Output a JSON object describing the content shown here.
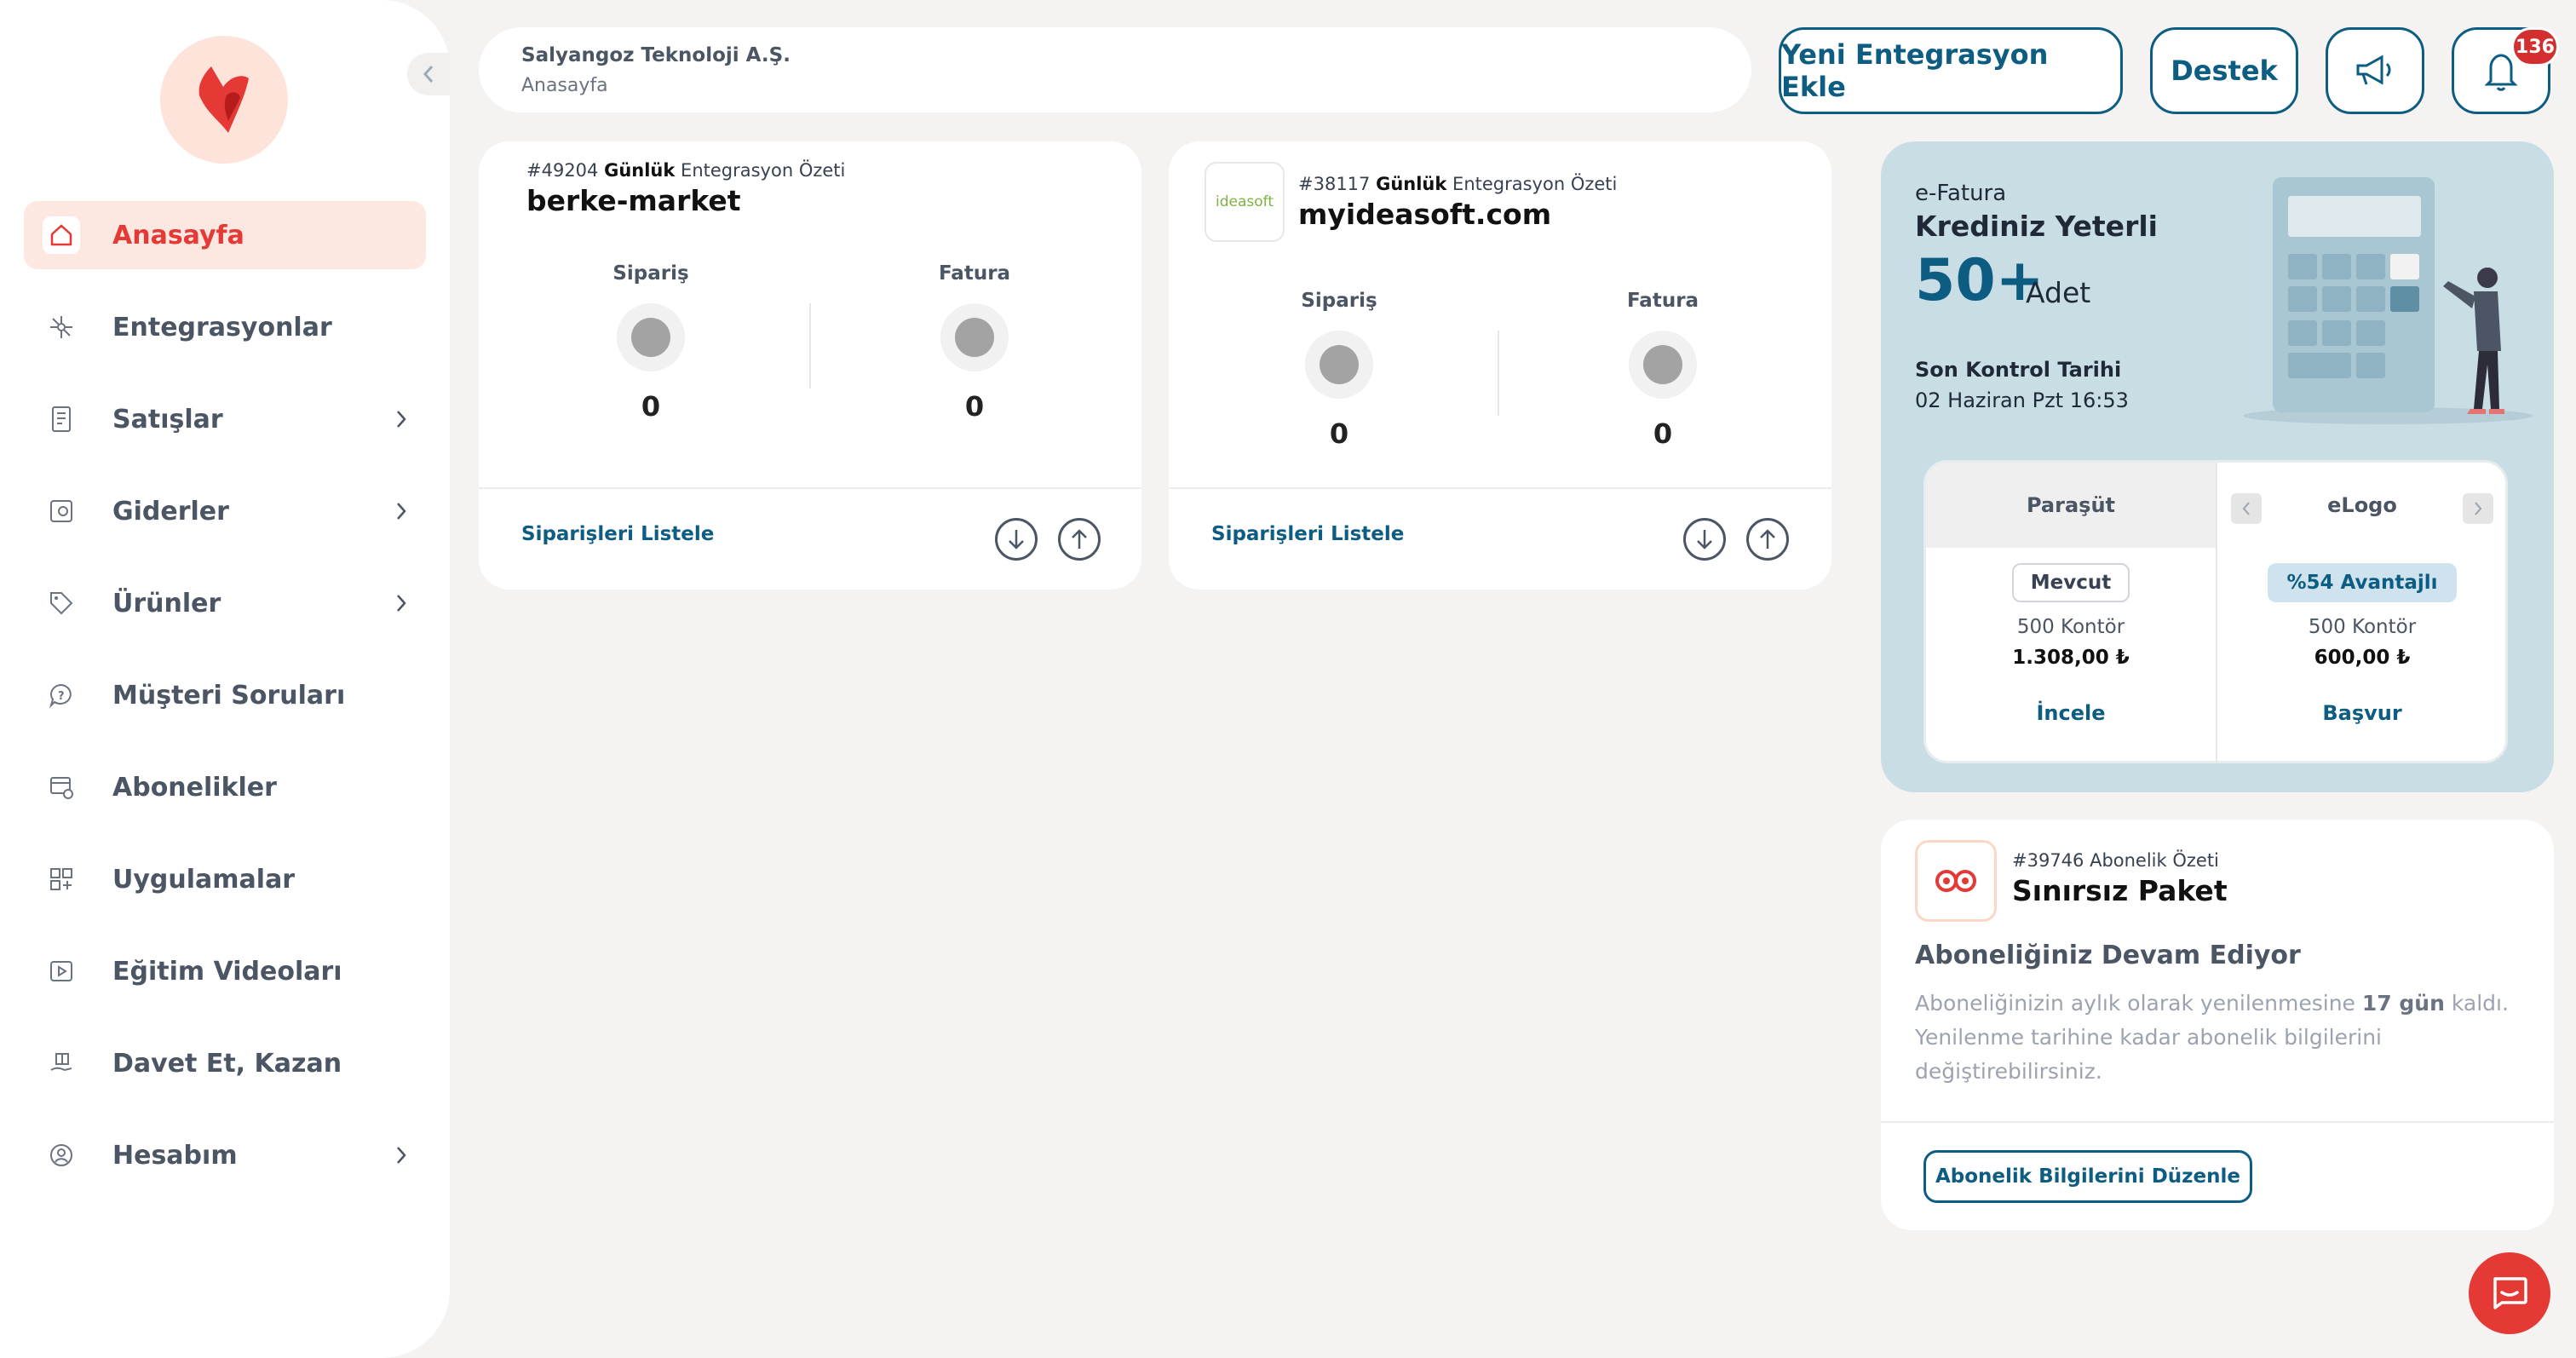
{
  "sidebar": {
    "items": [
      {
        "label": "Anasayfa",
        "icon": "home-icon",
        "active": true
      },
      {
        "label": "Entegrasyonlar",
        "icon": "integrations-icon"
      },
      {
        "label": "Satışlar",
        "icon": "sales-icon",
        "has_children": true
      },
      {
        "label": "Giderler",
        "icon": "expenses-icon",
        "has_children": true
      },
      {
        "label": "Ürünler",
        "icon": "tag-icon",
        "has_children": true
      },
      {
        "label": "Müşteri Soruları",
        "icon": "question-bubble-icon"
      },
      {
        "label": "Abonelikler",
        "icon": "subscription-icon"
      },
      {
        "label": "Uygulamalar",
        "icon": "apps-icon"
      },
      {
        "label": "Eğitim Videoları",
        "icon": "video-icon"
      },
      {
        "label": "Davet Et, Kazan",
        "icon": "gift-icon"
      },
      {
        "label": "Hesabım",
        "icon": "account-icon",
        "has_children": true
      }
    ]
  },
  "header": {
    "company": "Salyangoz Teknoloji A.Ş.",
    "breadcrumb": "Anasayfa",
    "add_integration_label": "Yeni Entegrasyon Ekle",
    "support_label": "Destek",
    "notification_count": "136"
  },
  "integrations": [
    {
      "id_text": "#49204",
      "kind": "Günlük",
      "suffix": "Entegrasyon Özeti",
      "name": "berke-market",
      "order_label": "Sipariş",
      "order_value": "0",
      "invoice_label": "Fatura",
      "invoice_value": "0",
      "list_label": "Siparişleri Listele"
    },
    {
      "id_text": "#38117",
      "kind": "Günlük",
      "suffix": "Entegrasyon Özeti",
      "name": "myideasoft.com",
      "logo_text": "ideasoft",
      "order_label": "Sipariş",
      "order_value": "0",
      "invoice_label": "Fatura",
      "invoice_value": "0",
      "list_label": "Siparişleri Listele"
    }
  ],
  "efatura": {
    "label": "e-Fatura",
    "title": "Krediniz Yeterli",
    "amount": "50+",
    "unit": "Adet",
    "check_label": "Son Kontrol Tarihi",
    "check_date": "02 Haziran Pzt 16:53",
    "providers": [
      {
        "name": "Paraşüt",
        "tag": "Mevcut",
        "credits": "500 Kontör",
        "price": "1.308,00 ₺",
        "action": "İncele"
      },
      {
        "name": "eLogo",
        "tag": "%54 Avantajlı",
        "credits": "500 Kontör",
        "price": "600,00 ₺",
        "action": "Başvur"
      }
    ]
  },
  "subscription": {
    "id_text": "#39746 Abonelik Özeti",
    "name": "Sınırsız Paket",
    "status": "Aboneliğiniz Devam Ediyor",
    "desc_part1": "Aboneliğinizin aylık olarak yenilenmesine ",
    "desc_bold": "17 gün",
    "desc_part2": " kaldı. Yenilenme tarihine kadar abonelik bilgilerini değiştirebilirsiniz.",
    "button_label": "Abonelik Bilgilerini Düzenle"
  },
  "colors": {
    "accent_red": "#e53935",
    "primary_blue": "#0d5c82",
    "panel_blue": "#c9dde5"
  }
}
